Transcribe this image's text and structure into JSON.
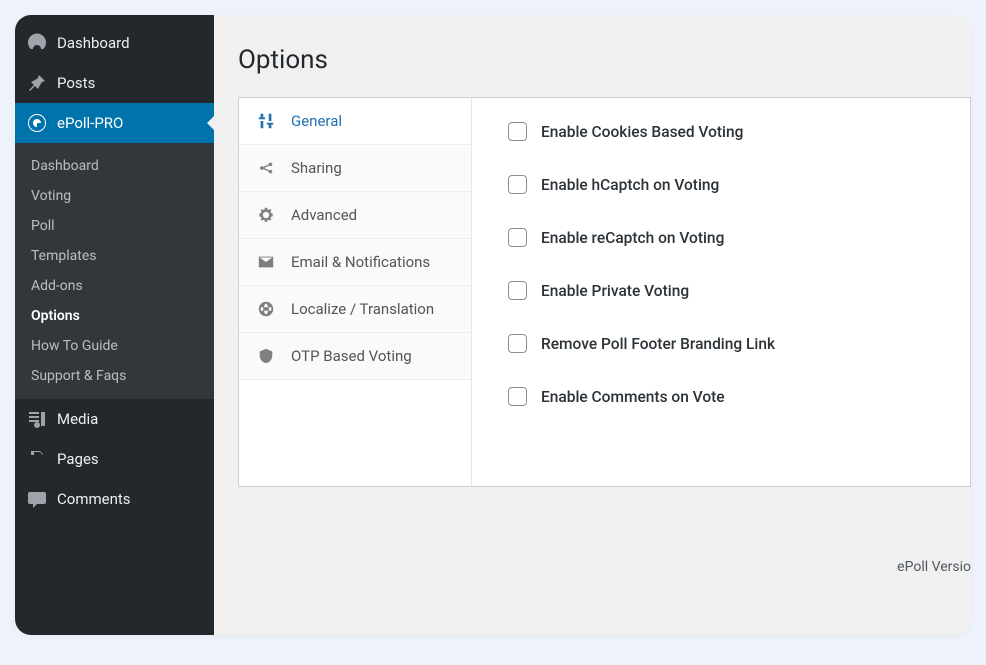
{
  "sidebar": {
    "topItems": [
      {
        "label": "Dashboard",
        "icon": "gauge-icon"
      },
      {
        "label": "Posts",
        "icon": "pin-icon"
      }
    ],
    "pluginItem": {
      "label": "ePoll-PRO",
      "icon": "epoll-icon"
    },
    "subItems": [
      {
        "label": "Dashboard"
      },
      {
        "label": "Voting"
      },
      {
        "label": "Poll"
      },
      {
        "label": "Templates"
      },
      {
        "label": "Add-ons"
      },
      {
        "label": "Options",
        "current": true
      },
      {
        "label": "How To Guide"
      },
      {
        "label": "Support & Faqs"
      }
    ],
    "bottomItems": [
      {
        "label": "Media",
        "icon": "media-icon"
      },
      {
        "label": "Pages",
        "icon": "pages-icon"
      },
      {
        "label": "Comments",
        "icon": "comment-icon"
      }
    ]
  },
  "content": {
    "title": "Options",
    "tabs": [
      {
        "label": "General",
        "icon": "sliders-icon",
        "active": true
      },
      {
        "label": "Sharing",
        "icon": "share-icon"
      },
      {
        "label": "Advanced",
        "icon": "gear-icon"
      },
      {
        "label": "Email & Notifications",
        "icon": "envelope-icon"
      },
      {
        "label": "Localize / Translation",
        "icon": "globe-icon"
      },
      {
        "label": "OTP Based Voting",
        "icon": "shield-icon"
      }
    ],
    "options": [
      {
        "label": "Enable Cookies Based Voting"
      },
      {
        "label": "Enable hCaptch on Voting"
      },
      {
        "label": "Enable reCaptch on Voting"
      },
      {
        "label": "Enable Private Voting"
      },
      {
        "label": "Remove Poll Footer Branding Link"
      },
      {
        "label": "Enable Comments on Vote"
      }
    ],
    "footerVersion": "ePoll Versio"
  }
}
